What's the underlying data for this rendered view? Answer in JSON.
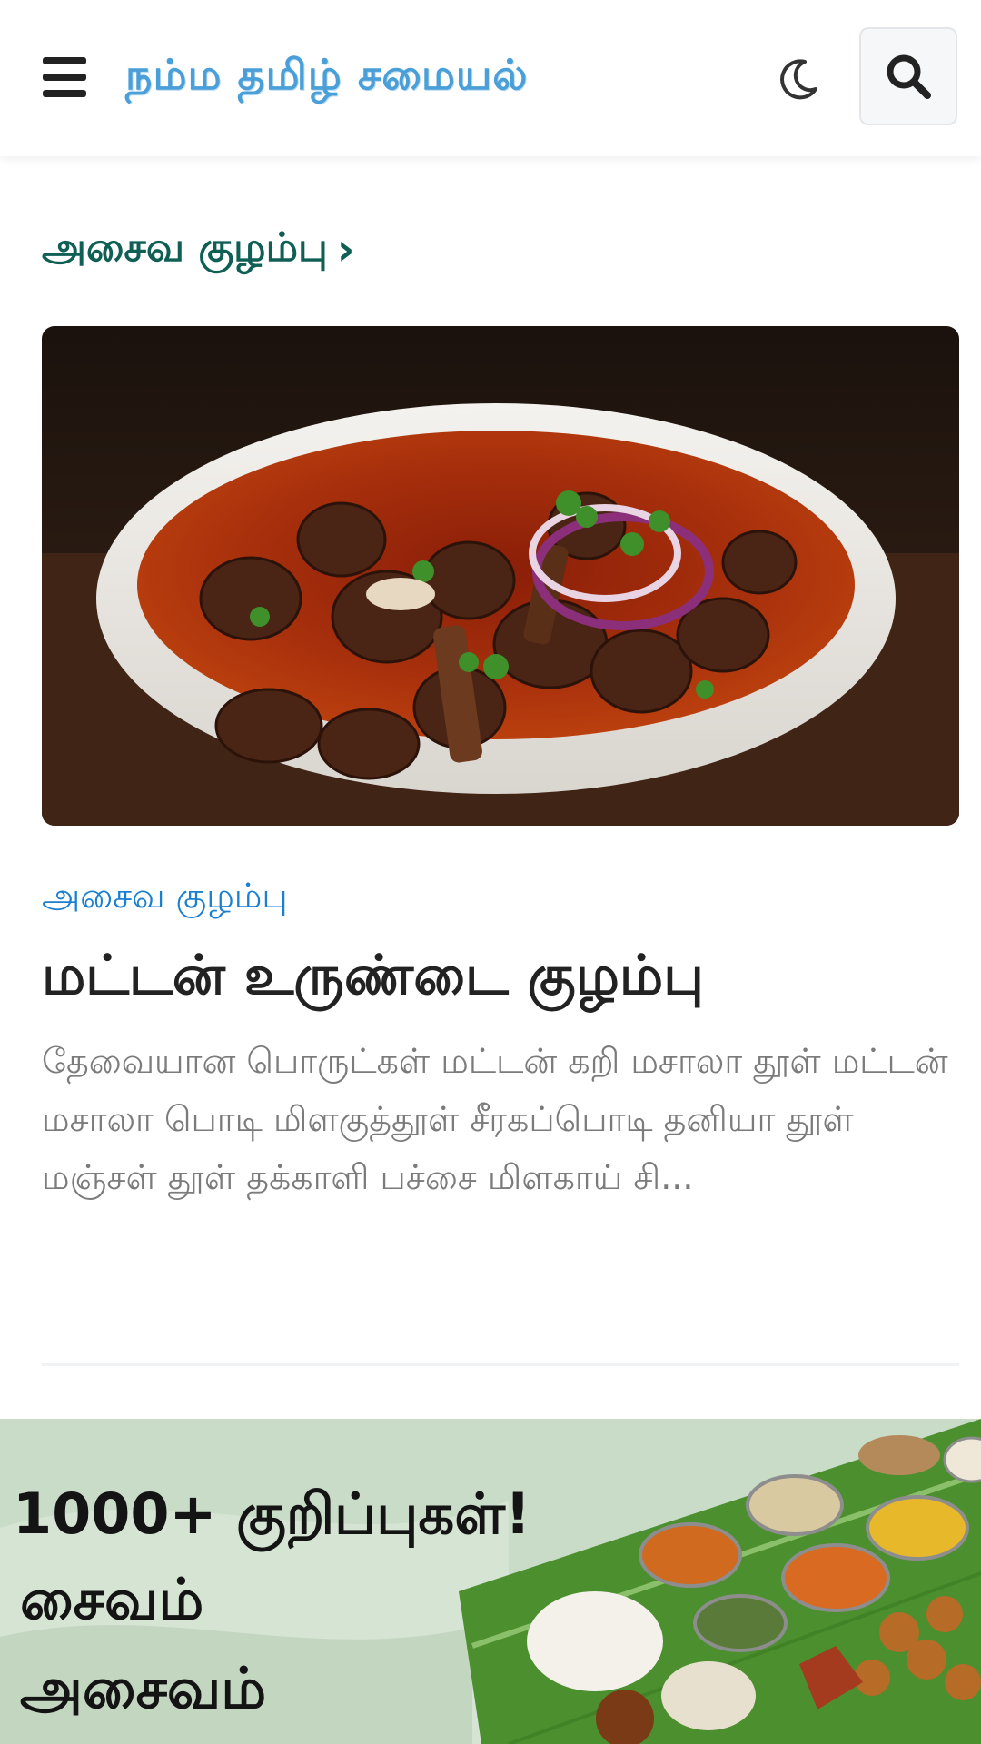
{
  "header": {
    "site_title": "நம்ம தமிழ் சமையல்",
    "menu_icon": "hamburger-menu-icon",
    "theme_icon": "moon-icon",
    "search_icon": "search-icon"
  },
  "section": {
    "heading": "அசைவ குழம்பு",
    "chevron": "›"
  },
  "article": {
    "category": "அசைவ குழம்பு",
    "title": "மட்டன் உருண்டை குழம்பு",
    "excerpt": "தேவையான பொருட்கள் மட்டன் கறி மசாலா தூள் மட்டன் மசாலா பொடி மிளகுத்தூள் சீரகப்பொடி தனியா தூள் மஞ்சள் தூள் தக்காளி பச்சை மிளகாய் சி..."
  },
  "promo": {
    "headline": "1000+ குறிப்புகள்!",
    "line1": "சைவம்",
    "line2": "அசைவம்"
  },
  "colors": {
    "title_blue": "#4a9fd8",
    "section_green": "#0f5f55",
    "category_blue": "#1b7fd0",
    "excerpt_gray": "#7b7b7b"
  }
}
